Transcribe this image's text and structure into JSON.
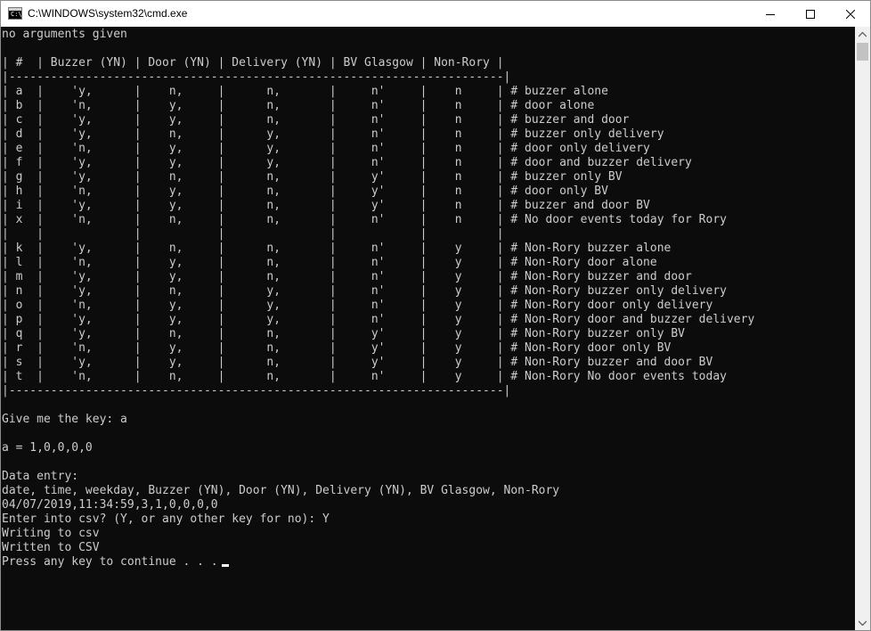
{
  "window": {
    "title": "C:\\WINDOWS\\system32\\cmd.exe",
    "icon": "console-icon"
  },
  "controls": {
    "minimize_icon": "minimize-icon",
    "maximize_icon": "maximize-icon",
    "close_icon": "close-icon"
  },
  "console": {
    "lines": [
      "no arguments given",
      "",
      "| #  | Buzzer (YN) | Door (YN) | Delivery (YN) | BV Glasgow | Non-Rory |",
      "|-----------------------------------------------------------------------|",
      "| a  |    'y,      |    n,     |      n,       |     n'     |    n     | # buzzer alone",
      "| b  |    'n,      |    y,     |      n,       |     n'     |    n     | # door alone",
      "| c  |    'y,      |    y,     |      n,       |     n'     |    n     | # buzzer and door",
      "| d  |    'y,      |    n,     |      y,       |     n'     |    n     | # buzzer only delivery",
      "| e  |    'n,      |    y,     |      y,       |     n'     |    n     | # door only delivery",
      "| f  |    'y,      |    y,     |      y,       |     n'     |    n     | # door and buzzer delivery",
      "| g  |    'y,      |    n,     |      n,       |     y'     |    n     | # buzzer only BV",
      "| h  |    'n,      |    y,     |      n,       |     y'     |    n     | # door only BV",
      "| i  |    'y,      |    y,     |      n,       |     y'     |    n     | # buzzer and door BV",
      "| x  |    'n,      |    n,     |      n,       |     n'     |    n     | # No door events today for Rory",
      "|    |             |           |               |            |          |",
      "| k  |    'y,      |    n,     |      n,       |     n'     |    y     | # Non-Rory buzzer alone",
      "| l  |    'n,      |    y,     |      n,       |     n'     |    y     | # Non-Rory door alone",
      "| m  |    'y,      |    y,     |      n,       |     n'     |    y     | # Non-Rory buzzer and door",
      "| n  |    'y,      |    n,     |      y,       |     n'     |    y     | # Non-Rory buzzer only delivery",
      "| o  |    'n,      |    y,     |      y,       |     n'     |    y     | # Non-Rory door only delivery",
      "| p  |    'y,      |    y,     |      y,       |     n'     |    y     | # Non-Rory door and buzzer delivery",
      "| q  |    'y,      |    n,     |      n,       |     y'     |    y     | # Non-Rory buzzer only BV",
      "| r  |    'n,      |    y,     |      n,       |     y'     |    y     | # Non-Rory door only BV",
      "| s  |    'y,      |    y,     |      n,       |     y'     |    y     | # Non-Rory buzzer and door BV",
      "| t  |    'n,      |    n,     |      n,       |     n'     |    y     | # Non-Rory No door events today",
      "|-----------------------------------------------------------------------|",
      "",
      "Give me the key: a",
      "",
      "a = 1,0,0,0,0",
      "",
      "Data entry:",
      "date, time, weekday, Buzzer (YN), Door (YN), Delivery (YN), BV Glasgow, Non-Rory",
      "04/07/2019,11:34:59,3,1,0,0,0,0",
      "Enter into csv? (Y, or any other key for no): Y",
      "Writing to csv",
      "Written to CSV"
    ],
    "prompt_line": "Press any key to continue . . ."
  },
  "scrollbar": {
    "up_icon": "scroll-up-arrow-icon",
    "down_icon": "scroll-down-arrow-icon"
  }
}
